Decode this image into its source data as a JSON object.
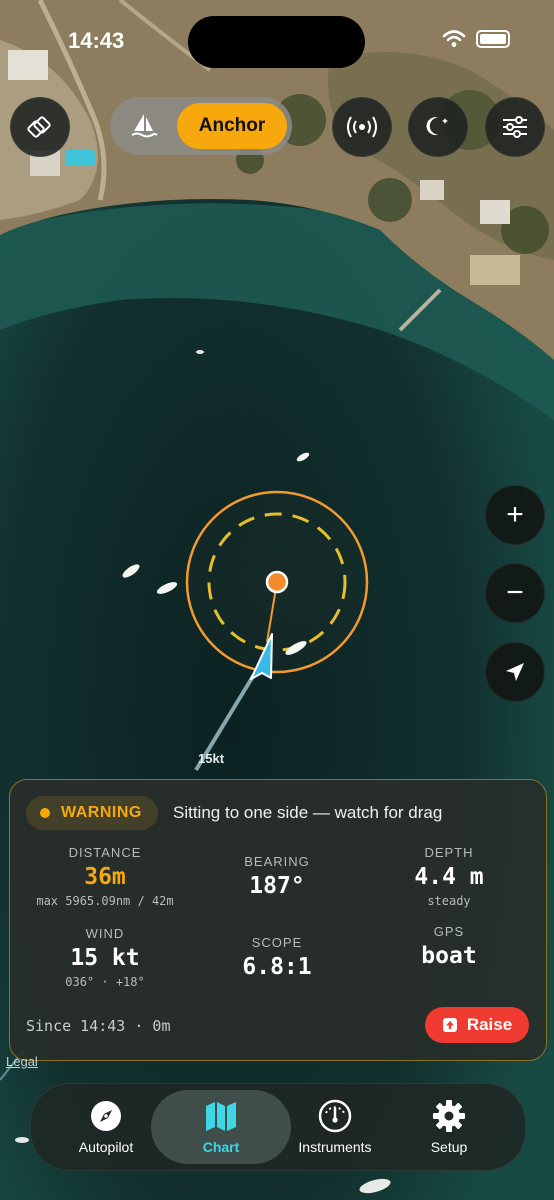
{
  "status_bar": {
    "time": "14:43"
  },
  "top_controls": {
    "layers_icon": "layers-icon",
    "mode_toggle": {
      "options": [
        "sail",
        "Anchor"
      ],
      "selected": "Anchor",
      "sail_icon": "sailboat-icon"
    },
    "broadcast_icon": "broadcast-icon",
    "night_mode_icon": "moon-icon",
    "settings_icon": "sliders-icon"
  },
  "map": {
    "wind_speed_label": "15kt"
  },
  "map_controls": {
    "zoom_in": "+",
    "zoom_out": "−",
    "locate_icon": "location-arrow-icon"
  },
  "alert": {
    "level": "WARNING",
    "message": "Sitting to one side — watch for drag",
    "stats": {
      "distance": {
        "label": "DISTANCE",
        "value": "36m",
        "sub": "max 5965.09nm / 42m"
      },
      "bearing": {
        "label": "BEARING",
        "value": "187°"
      },
      "depth": {
        "label": "DEPTH",
        "value": "4.4 m",
        "sub": "steady"
      },
      "wind": {
        "label": "WIND",
        "value": "15 kt",
        "sub": "036° · +18°"
      },
      "scope": {
        "label": "SCOPE",
        "value": "6.8:1"
      },
      "gps": {
        "label": "GPS",
        "value": "boat"
      }
    },
    "since": "Since 14:43 · 0m",
    "raise_label": "Raise"
  },
  "legal_link": "Legal",
  "tab_bar": {
    "items": [
      {
        "label": "Autopilot",
        "icon": "compass-icon"
      },
      {
        "label": "Chart",
        "icon": "map-icon"
      },
      {
        "label": "Instruments",
        "icon": "gauge-icon"
      },
      {
        "label": "Setup",
        "icon": "gear-icon"
      }
    ],
    "active": "Chart"
  },
  "colors": {
    "accent": "#f7a80c",
    "danger": "#ef3b31",
    "active_tab": "#3fd6e6",
    "boat_arrow": "#39b8ea"
  }
}
